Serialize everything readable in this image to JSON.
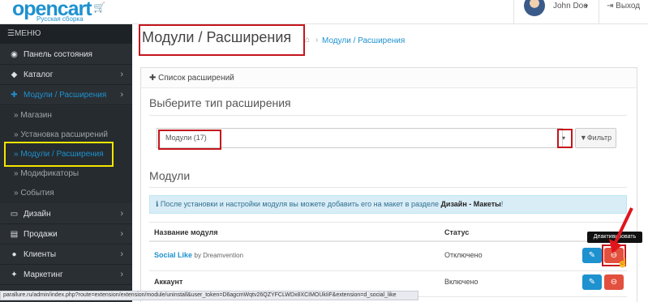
{
  "header": {
    "logo": "opencart",
    "logo_sub": "Русская сборка",
    "user_name": "John Doe",
    "user_caret": "▾",
    "logout_label": "Выход",
    "logout_icon": "sign-out-icon"
  },
  "sidebar": {
    "menu_label": "МЕНЮ",
    "items": [
      {
        "label": "Панель состояния",
        "icon": "dashboard-icon"
      },
      {
        "label": "Каталог",
        "icon": "tag-icon"
      },
      {
        "label": "Модули / Расширения",
        "icon": "puzzle-icon"
      },
      {
        "label": "Дизайн",
        "icon": "desktop-icon"
      },
      {
        "label": "Продажи",
        "icon": "cart-icon"
      },
      {
        "label": "Клиенты",
        "icon": "user-icon"
      },
      {
        "label": "Маркетинг",
        "icon": "share-icon"
      }
    ],
    "sub_items": [
      {
        "label": "Магазин"
      },
      {
        "label": "Установка расширений"
      },
      {
        "label": "Модули / Расширения"
      },
      {
        "label": "Модификаторы"
      },
      {
        "label": "События"
      }
    ]
  },
  "main": {
    "title": "Модули / Расширения",
    "breadcrumb": "Модули / Расширения",
    "panel_title": "Список расширений",
    "choose_type_title": "Выберите тип расширения",
    "select_value": "Модули (17)",
    "filter_label": "Фильтр",
    "modules_title": "Модули",
    "alert_text": "После установки и настройки модуля вы можете добавить его на макет в разделе ",
    "alert_link": "Дизайн - Макеты",
    "alert_end": "!",
    "table": {
      "headers": [
        "Название модуля",
        "Статус"
      ],
      "rows": [
        {
          "name": "Social Like",
          "by": "by Dreamvention",
          "status": "Отключено"
        },
        {
          "name": "Аккаунт",
          "by": "",
          "status": "Включено"
        }
      ]
    },
    "tooltip": "Деактивировать"
  },
  "status_bar": "parallure.ru/admin/index.php?route=extension/extension/module/uninstall&user_token=D6agcmWqtv26QZYFCLWDx8XCIMOUkIiF&extension=d_social_like",
  "colors": {
    "accent": "#1e91cf",
    "danger": "#e3503e",
    "sidebar": "#2a2f33",
    "highlight": "#c4151c"
  }
}
